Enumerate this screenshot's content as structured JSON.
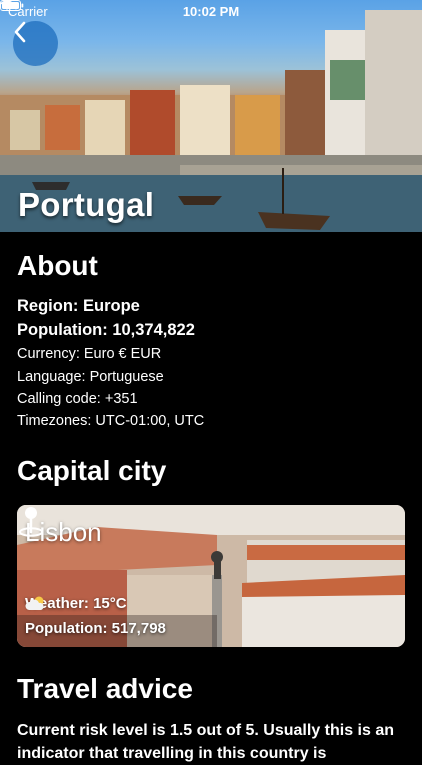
{
  "status_bar": {
    "carrier": "Carrier",
    "time": "10:02 PM"
  },
  "hero": {
    "title": "Portugal",
    "back_icon": "chevron-left-icon"
  },
  "about": {
    "heading": "About",
    "region": "Region: Europe",
    "population": "Population: 10,374,822",
    "currency": "Currency: Euro € EUR",
    "language": "Language: Portuguese",
    "calling_code": "Calling code: +351",
    "timezones": "Timezones: UTC-01:00, UTC"
  },
  "capital": {
    "heading": "Capital city",
    "city": "Lisbon",
    "weather": "Weather: 15°C",
    "weather_icon": "cloud-sun-icon",
    "population": "Population: 517,798",
    "map_icon": "map-pin-icon"
  },
  "travel": {
    "heading": "Travel advice",
    "text": "Current risk level is 1.5 out of 5. Usually this is an indicator that travelling in this country is"
  },
  "colors": {
    "background": "#000000",
    "back_button": "#1e6ebe"
  }
}
